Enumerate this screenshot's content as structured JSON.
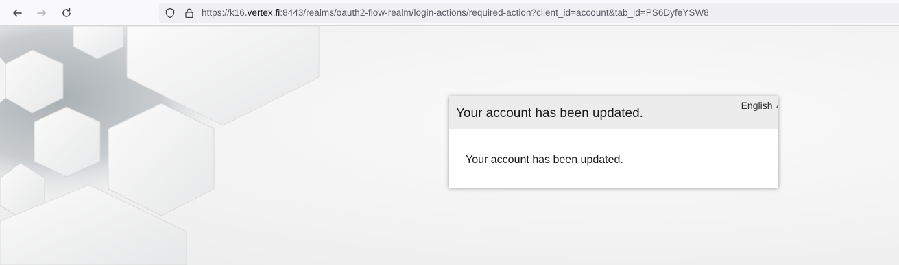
{
  "browser": {
    "back_icon": "arrow-left-icon",
    "forward_icon": "arrow-right-icon",
    "reload_icon": "reload-icon",
    "tracking_icon": "shield-icon",
    "lock_icon": "lock-icon",
    "url_prefix": "https://k16.",
    "url_host": "vertex.fi",
    "url_suffix": ":8443/realms/oauth2-flow-realm/login-actions/required-action?client_id=account&tab_id=PS6DyfeYSW8"
  },
  "card": {
    "title": "Your account has been updated.",
    "language": "English",
    "language_chevron": "v",
    "message": "Your account has been updated."
  },
  "colors": {
    "header_bg": "#ececec",
    "card_bg": "#ffffff",
    "page_bg": "#f2f3f3"
  }
}
